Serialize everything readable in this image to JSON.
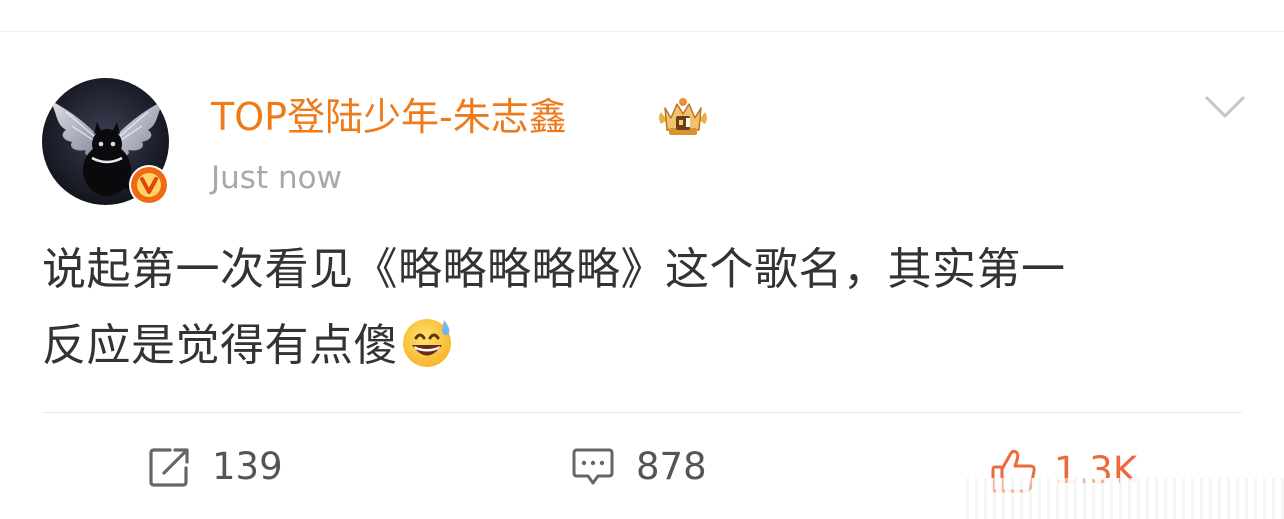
{
  "post": {
    "author": {
      "name": "TOP登陆少年-朱志鑫",
      "avatar_icon": "black-cat-with-silver-wings-avatar",
      "verified_icon": "orange-v-verified-icon",
      "badge_icon": "crown-member-icon"
    },
    "timestamp": "Just now",
    "menu_icon": "chevron-down-icon",
    "text_lines": [
      "说起第一次看见《略略略略略》这个歌名，其实第一",
      "反应是觉得有点傻"
    ],
    "inline_emoji": "grinning-sweat-emoji"
  },
  "actions": {
    "repost": {
      "icon": "repost-icon",
      "count": "139"
    },
    "comment": {
      "icon": "comment-icon",
      "count": "878"
    },
    "like": {
      "icon": "thumbs-up-icon",
      "count": "1.3K"
    }
  },
  "colors": {
    "username": "#ef7a1a",
    "timestamp": "#a8a8a8",
    "body_text": "#333333",
    "like_accent": "#ef6a3a",
    "verified_badge": "#f06a12"
  }
}
